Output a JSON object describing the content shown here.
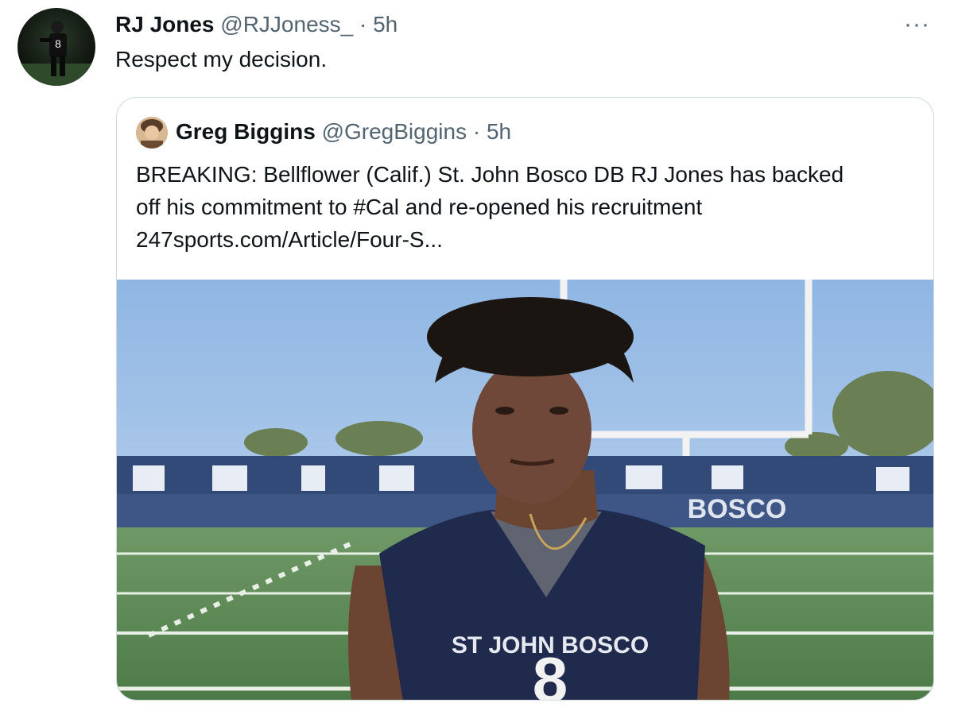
{
  "tweet": {
    "author_name": "RJ Jones",
    "author_handle": "@RJJoness_",
    "separator": "·",
    "time": "5h",
    "more_label": "···",
    "text": "Respect my decision."
  },
  "quoted_tweet": {
    "author_name": "Greg Biggins",
    "author_handle": "@GregBiggins",
    "separator": "·",
    "time": "5h",
    "text_line1": "BREAKING: Bellflower (Calif.) St. John Bosco DB RJ Jones has backed",
    "text_line2": "off his commitment to #Cal and re-opened his recruitment",
    "link": "247sports.com/Article/Four-S...",
    "media": {
      "jersey_text": "ST JOHN BOSCO",
      "jersey_number": "8",
      "stadium_sign": "BOSCO"
    }
  },
  "colors": {
    "text_primary": "#0f1419",
    "text_secondary": "#536471",
    "border": "#cfd9de",
    "sky": "#a9c8ea",
    "field": "#5b8a55",
    "jersey": "#1f2a4d"
  }
}
